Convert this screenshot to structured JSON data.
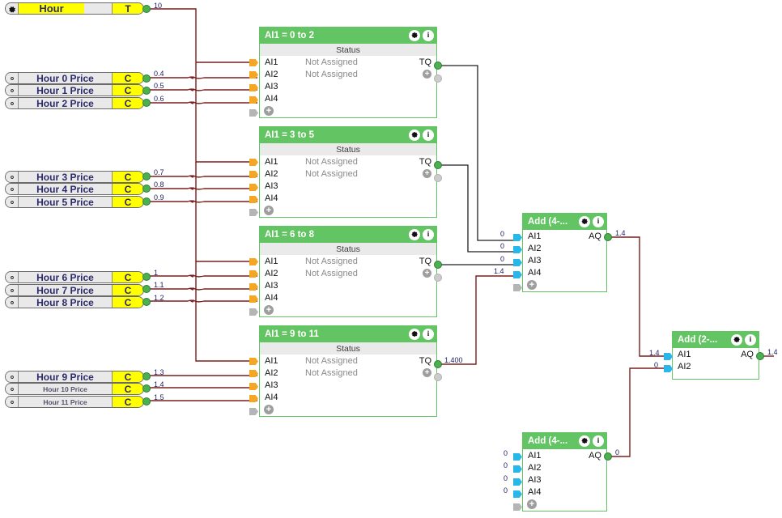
{
  "app": {
    "kind": "function-block-diagram-editor",
    "colors": {
      "block_header_green": "#62c462",
      "wire_signal": "#7a1f1f",
      "wire_logic": "#1a1a1a",
      "pin_input_analog": "#f5a623",
      "pin_input_add": "#29b6e8",
      "pin_output": "#4caf50",
      "label_text": "#1a1a5e",
      "variable_yellow": "#ffff00",
      "variable_grey": "#e9e9e9"
    }
  },
  "variables": [
    {
      "id": "hour",
      "name": "Hour",
      "tail": "T",
      "value": "10",
      "style": "hour"
    },
    {
      "id": "h0",
      "name": "Hour 0 Price",
      "tail": "C",
      "value": "0.4",
      "style": "price"
    },
    {
      "id": "h1",
      "name": "Hour 1 Price",
      "tail": "C",
      "value": "0.5",
      "style": "price"
    },
    {
      "id": "h2",
      "name": "Hour 2 Price",
      "tail": "C",
      "value": "0.6",
      "style": "price"
    },
    {
      "id": "h3",
      "name": "Hour 3 Price",
      "tail": "C",
      "value": "0.7",
      "style": "price"
    },
    {
      "id": "h4",
      "name": "Hour 4 Price",
      "tail": "C",
      "value": "0.8",
      "style": "price"
    },
    {
      "id": "h5",
      "name": "Hour 5 Price",
      "tail": "C",
      "value": "0.9",
      "style": "price"
    },
    {
      "id": "h6",
      "name": "Hour 6 Price",
      "tail": "C",
      "value": "1",
      "style": "price"
    },
    {
      "id": "h7",
      "name": "Hour 7 Price",
      "tail": "C",
      "value": "1.1",
      "style": "price"
    },
    {
      "id": "h8",
      "name": "Hour 8 Price",
      "tail": "C",
      "value": "1.2",
      "style": "price"
    },
    {
      "id": "h9",
      "name": "Hour 9 Price",
      "tail": "C",
      "value": "1.3",
      "style": "price"
    },
    {
      "id": "h10",
      "name": "Hour 10 Price",
      "tail": "C",
      "value": "1.4",
      "style": "price-small"
    },
    {
      "id": "h11",
      "name": "Hour 11 Price",
      "tail": "C",
      "value": "1.5",
      "style": "price-small"
    }
  ],
  "common": {
    "status_header": "Status",
    "not_assigned": "Not Assigned",
    "input_labels": [
      "AI1",
      "AI2",
      "AI3",
      "AI4"
    ],
    "output_tq": "TQ",
    "output_aq": "AQ",
    "gear_icon": "gear-icon",
    "info_icon": "info-icon",
    "plus_icon": "plus-icon"
  },
  "blocks": [
    {
      "id": "b0",
      "title": "AI1 = 0 to 2",
      "inputs": [
        "AI1",
        "AI2",
        "AI3",
        "AI4"
      ],
      "status": [
        "Not Assigned",
        "Not Assigned"
      ],
      "output_label": "TQ",
      "output_value": ""
    },
    {
      "id": "b1",
      "title": "AI1 = 3 to 5",
      "inputs": [
        "AI1",
        "AI2",
        "AI3",
        "AI4"
      ],
      "status": [
        "Not Assigned",
        "Not Assigned"
      ],
      "output_label": "TQ",
      "output_value": ""
    },
    {
      "id": "b2",
      "title": "AI1 = 6 to 8",
      "inputs": [
        "AI1",
        "AI2",
        "AI3",
        "AI4"
      ],
      "status": [
        "Not Assigned",
        "Not Assigned"
      ],
      "output_label": "TQ",
      "output_value": ""
    },
    {
      "id": "b3",
      "title": "AI1 = 9 to 11",
      "inputs": [
        "AI1",
        "AI2",
        "AI3",
        "AI4"
      ],
      "status": [
        "Not Assigned",
        "Not Assigned"
      ],
      "output_label": "TQ",
      "output_value": "1.400"
    }
  ],
  "add_blocks": [
    {
      "id": "addA",
      "title": "Add  (4-...",
      "inputs": [
        "AI1",
        "AI2",
        "AI3",
        "AI4"
      ],
      "input_values": [
        "0",
        "0",
        "0",
        "1.4"
      ],
      "output_label": "AQ",
      "output_value": "1.4"
    },
    {
      "id": "addB",
      "title": "Add  (2-...",
      "inputs": [
        "AI1",
        "AI2"
      ],
      "input_values": [
        "1.4",
        "0"
      ],
      "output_label": "AQ",
      "output_value": "1.4"
    },
    {
      "id": "addC",
      "title": "Add  (4-...",
      "inputs": [
        "AI1",
        "AI2",
        "AI3",
        "AI4"
      ],
      "input_values": [
        "0",
        "0",
        "0",
        "0"
      ],
      "output_label": "AQ",
      "output_value": "0"
    }
  ]
}
